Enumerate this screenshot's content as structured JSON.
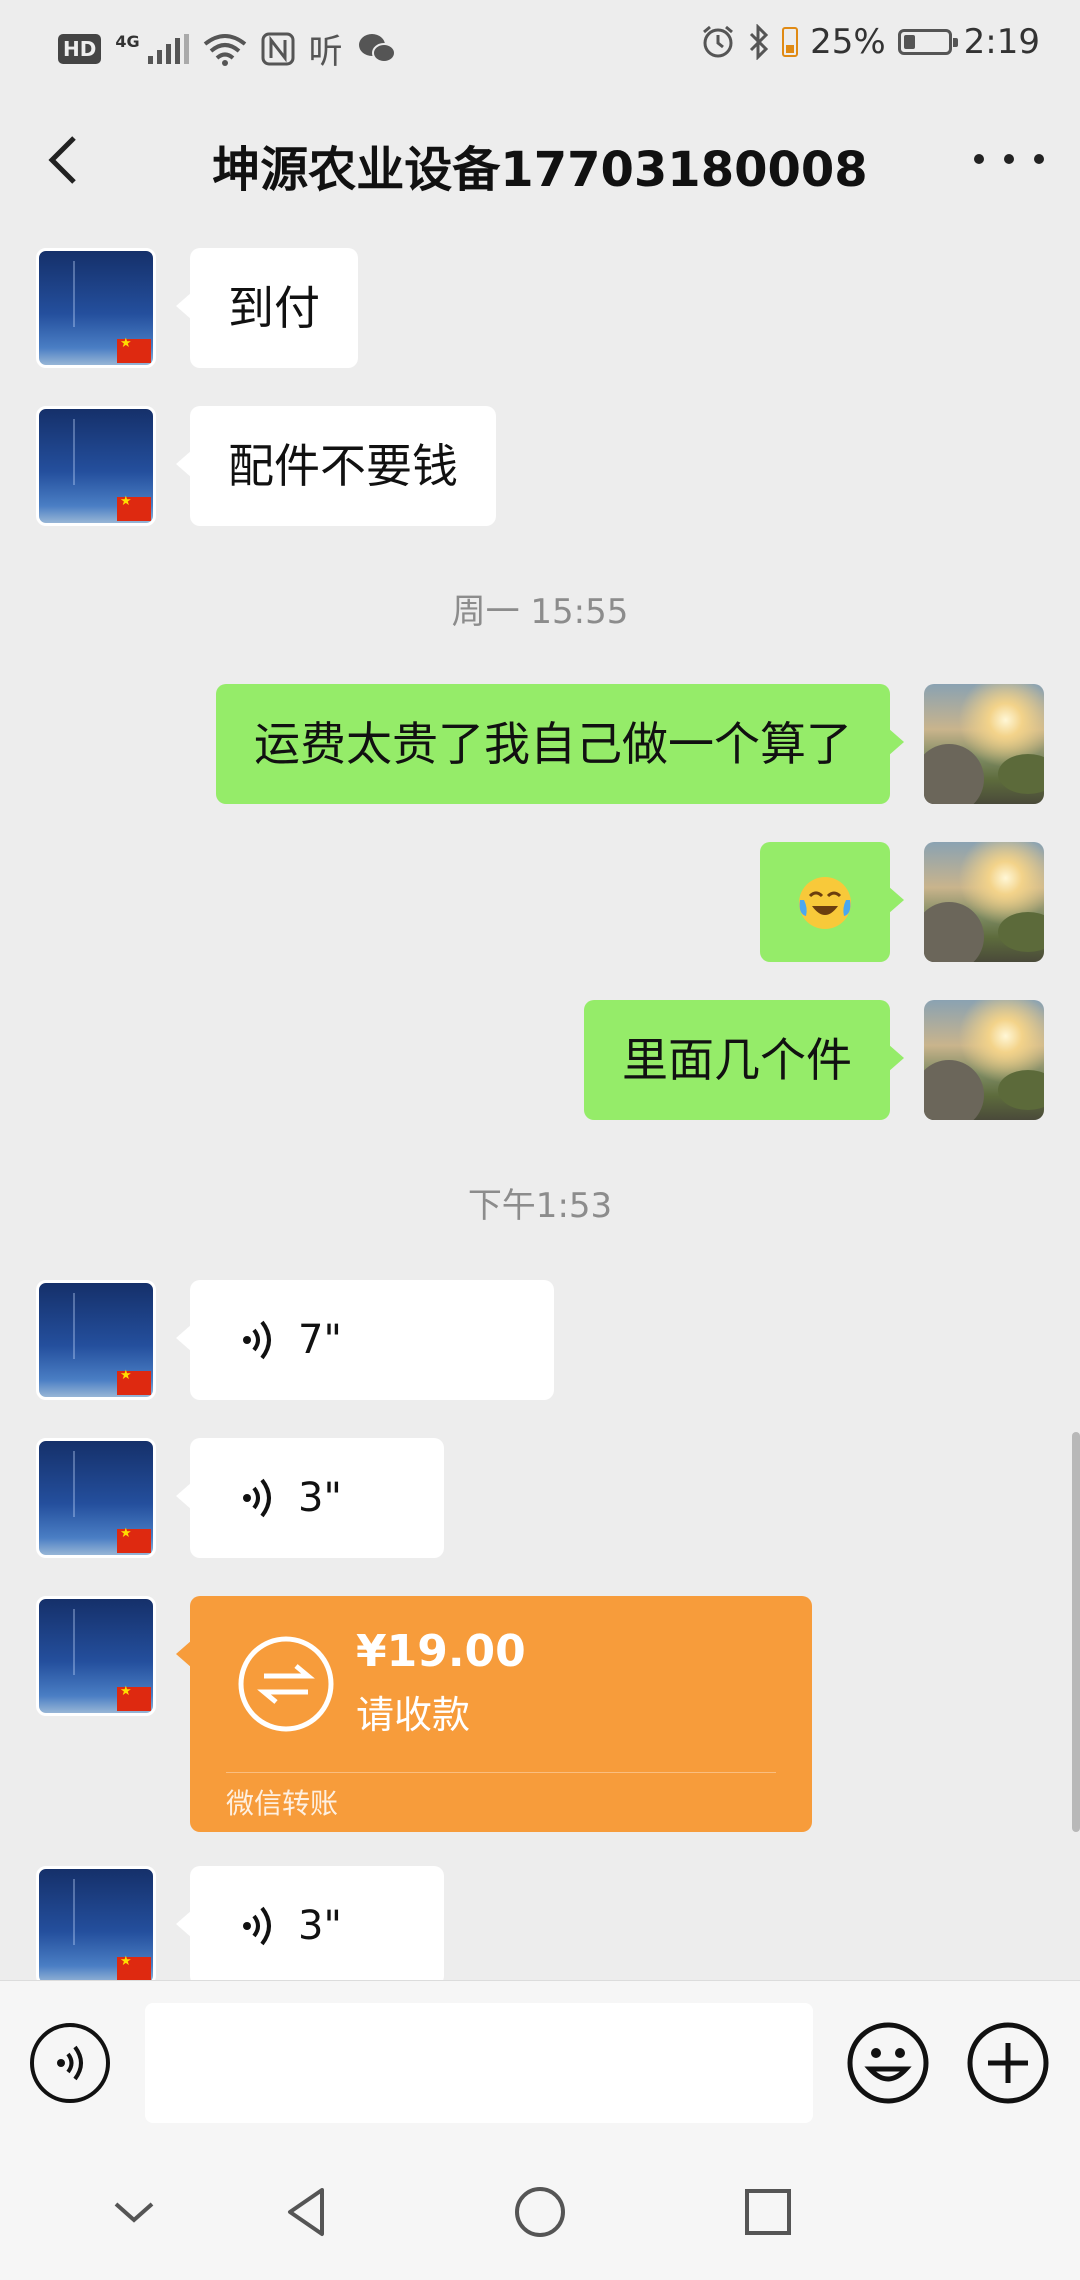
{
  "status_bar": {
    "hd": "HD",
    "network": "4G",
    "listen_glyph": "听",
    "battery_percent": "25%",
    "time": "2:19",
    "battery_level": 0.25,
    "icons": [
      "signal-icon",
      "wifi-icon",
      "nfc-icon",
      "wechat-icon",
      "alarm-icon",
      "bluetooth-icon",
      "battery-icon"
    ]
  },
  "header": {
    "title": "坤源农业设备17703180008",
    "back_icon": "chevron-left-icon",
    "more_icon": "more-dots-icon"
  },
  "messages": [
    {
      "side": "left",
      "type": "text",
      "text": "到付"
    },
    {
      "side": "left",
      "type": "text",
      "text": "配件不要钱"
    },
    {
      "type": "time",
      "text": "周一 15:55"
    },
    {
      "side": "right",
      "type": "text",
      "text": "运费太贵了我自己做一个算了"
    },
    {
      "side": "right",
      "type": "emoji",
      "icon": "face-with-tears-of-joy-emoji"
    },
    {
      "side": "right",
      "type": "text",
      "text": "里面几个件"
    },
    {
      "type": "time",
      "text": "下午1:53"
    },
    {
      "side": "left",
      "type": "voice",
      "duration": "7\""
    },
    {
      "side": "left",
      "type": "voice",
      "duration": "3\""
    },
    {
      "side": "left",
      "type": "transfer",
      "amount": "¥19.00",
      "label": "请收款",
      "brand": "微信转账"
    },
    {
      "side": "left",
      "type": "voice",
      "duration": "3\""
    }
  ],
  "input_bar": {
    "voice_icon": "voice-input-icon",
    "emoji_icon": "emoji-icon",
    "plus_icon": "plus-icon"
  },
  "nav_bar": {
    "icons": [
      "collapse-icon",
      "back-triangle-icon",
      "home-circle-icon",
      "recents-square-icon"
    ]
  },
  "colors": {
    "background": "#ededed",
    "sent_bubble": "#95ec69",
    "received_bubble": "#ffffff",
    "transfer_card": "#f79c3b"
  }
}
